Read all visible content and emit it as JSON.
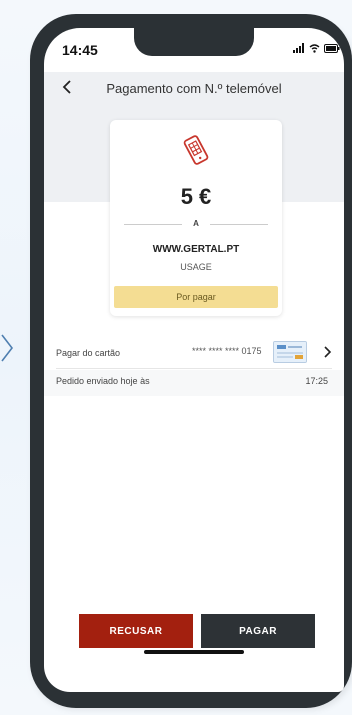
{
  "status_bar": {
    "time": "14:45"
  },
  "header": {
    "title": "Pagamento com N.º telemóvel"
  },
  "payment_card": {
    "amount": "5 €",
    "to_label": "A",
    "merchant": "WWW.GERTAL.PT",
    "description": "USAGE",
    "status": "Por pagar"
  },
  "details": {
    "card_label": "Pagar do cartão",
    "card_number": "**** **** **** 0175",
    "sent_label": "Pedido enviado hoje às",
    "sent_time": "17:25"
  },
  "actions": {
    "decline_label": "RECUSAR",
    "pay_label": "PAGAR"
  },
  "colors": {
    "accent_red": "#a3200f",
    "dark_button": "#2d3236",
    "status_yellow": "#f4dd93",
    "phone_frame": "#2b3135"
  },
  "icons": [
    "chevron-right-icon",
    "back-icon",
    "phone-payment-icon",
    "signal-icon",
    "wifi-icon",
    "battery-icon",
    "card-thumbnail-icon",
    "chevron-right-icon"
  ]
}
